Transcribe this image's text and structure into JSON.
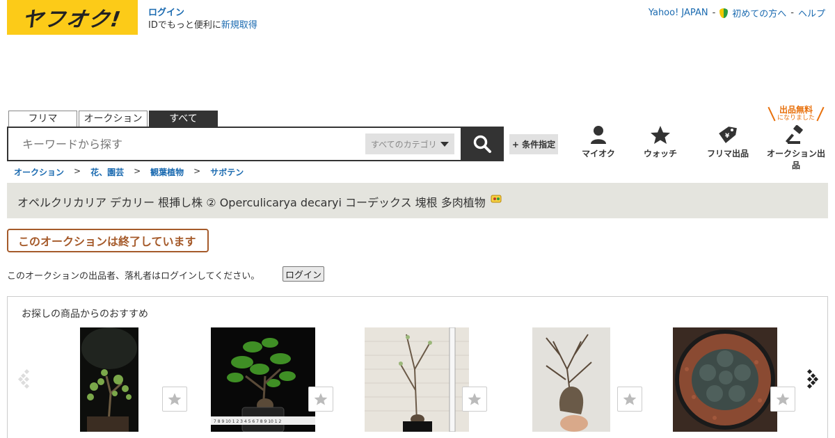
{
  "header": {
    "logo_text": "ヤフオク!",
    "login_label": "ログイン",
    "login_sub_prefix": "IDでもっと便利に",
    "signup_label": "新規取得",
    "nav": {
      "yahoo_japan": "Yahoo! JAPAN",
      "beginner": "初めての方へ",
      "help": "ヘルプ"
    }
  },
  "search": {
    "tabs": [
      {
        "label": "フリマ",
        "active": false
      },
      {
        "label": "オークション",
        "active": false
      },
      {
        "label": "すべて",
        "active": true
      }
    ],
    "placeholder": "キーワードから探す",
    "category_label": "すべてのカテゴリ",
    "condition_label": "+ 条件指定"
  },
  "quick_links": {
    "myauc": "マイオク",
    "watch": "ウォッチ",
    "flea_listing": "フリマ出品",
    "auction_listing": "オークション出品",
    "free_badge": "出品無料",
    "free_badge_sub": "になりました"
  },
  "breadcrumb": [
    "オークション",
    "花、園芸",
    "観葉植物",
    "サボテン"
  ],
  "item": {
    "title": "オペルクリカリア デカリー 根挿し株 ② Operculicarya decaryi コーデックス 塊根 多肉植物",
    "ended_label": "このオークションは終了しています",
    "notice": "このオークションの出品者、落札者はログインしてください。",
    "notice_button": "ログイン"
  },
  "recommendations": {
    "title": "お探しの商品からのおすすめ",
    "items": [
      {
        "image": "bonsai-tree-dark"
      },
      {
        "image": "bonsai-pot-ruler"
      },
      {
        "image": "tall-thin-plant"
      },
      {
        "image": "caudex-tree-hand"
      },
      {
        "image": "cactus-top"
      }
    ]
  },
  "colors": {
    "brand_yellow": "#fccb18",
    "link_blue": "#1a6ab0",
    "ended_brown": "#a55a2a",
    "badge_orange": "#e8700b"
  }
}
